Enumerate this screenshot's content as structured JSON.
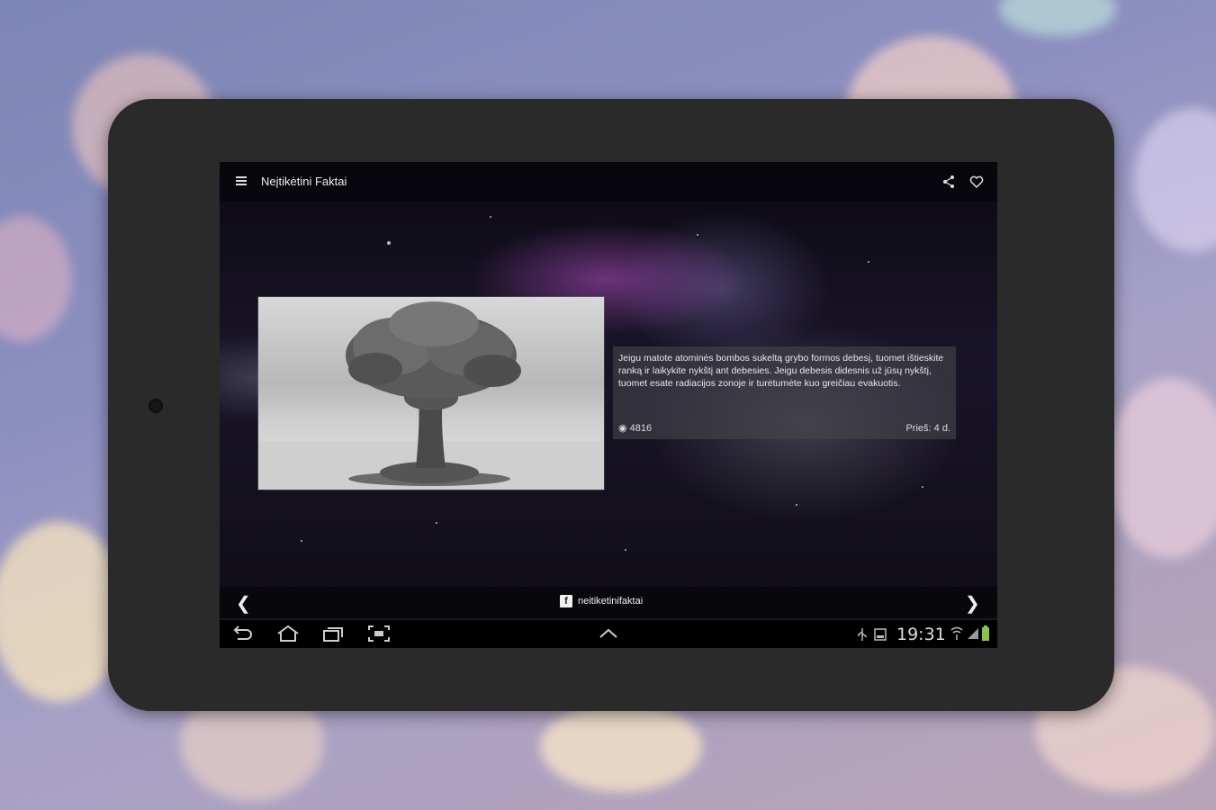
{
  "app_bar": {
    "title": "Neįtikėtini Faktai",
    "icons": [
      "menu-icon",
      "share-icon",
      "heart-icon"
    ]
  },
  "fact": {
    "text": "Jeigu matote atominės bombos sukeltą grybo formos debesį, tuomet ištieskite ranką ir laikykite nykštį ant debesies. Jeigu debesis didesnis už jūsų nykštį, tuomet esate radiacijos zonoje ir turėtumėte kuo greičiau evakuotis.",
    "views": "4816",
    "time_ago": "Prieš: 4 d.",
    "image": "mushroom-cloud-photo"
  },
  "bottom_nav": {
    "prev_icon": "chevron-left-icon",
    "next_icon": "chevron-right-icon",
    "facebook_handle": "neitiketinifaktai",
    "facebook_icon_letter": "f"
  },
  "system_bar": {
    "clock": "19:31",
    "buttons": [
      "back-icon",
      "home-icon",
      "recent-apps-icon",
      "screenshot-icon",
      "up-chevron-icon"
    ],
    "status_icons": [
      "usb-icon",
      "storage-icon",
      "wifi-icon",
      "signal-icon",
      "battery-icon"
    ],
    "battery_color": "#8bc34a"
  }
}
